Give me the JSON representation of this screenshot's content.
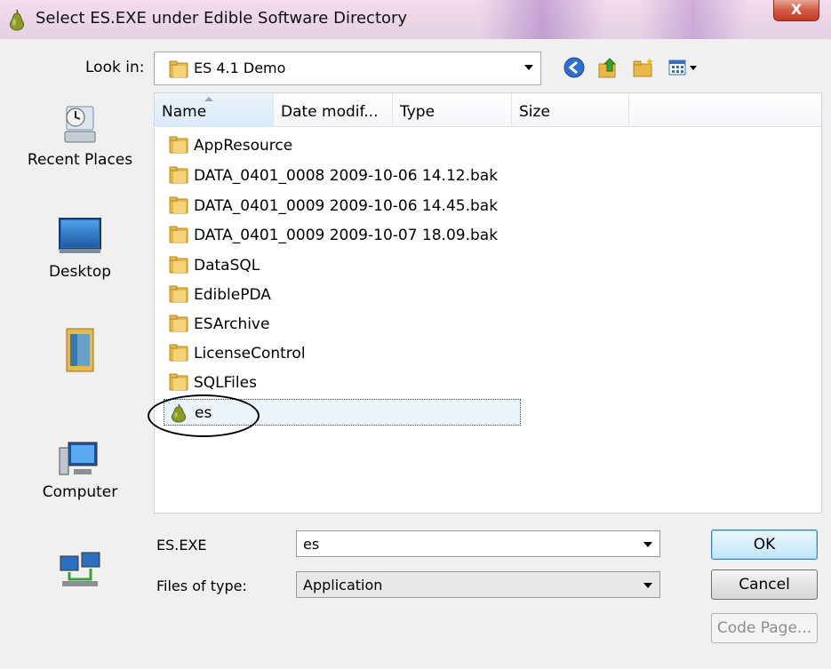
{
  "window": {
    "title": "Select ES.EXE under Edible Software Directory",
    "close_glyph": "X"
  },
  "toolbar": {
    "lookin_label": "Look in:",
    "lookin_value": "ES 4.1 Demo",
    "buttons": [
      "back-icon",
      "up-folder-icon",
      "new-folder-icon",
      "views-menu-icon"
    ]
  },
  "places": [
    {
      "label": "Recent Places",
      "icon": "recent-places-icon"
    },
    {
      "label": "Desktop",
      "icon": "desktop-icon"
    },
    {
      "label": "",
      "icon": "user-folder-icon"
    },
    {
      "label": "Computer",
      "icon": "computer-icon"
    },
    {
      "label": "",
      "icon": "network-icon"
    }
  ],
  "columns": [
    "Name",
    "Date modif...",
    "Type",
    "Size"
  ],
  "files": [
    {
      "name": "AppResource",
      "icon": "folder-icon"
    },
    {
      "name": "DATA_0401_0008 2009-10-06 14.12.bak",
      "icon": "folder-icon"
    },
    {
      "name": "DATA_0401_0009 2009-10-06 14.45.bak",
      "icon": "folder-icon"
    },
    {
      "name": "DATA_0401_0009 2009-10-07 18.09.bak",
      "icon": "folder-icon"
    },
    {
      "name": "DataSQL",
      "icon": "folder-icon"
    },
    {
      "name": "EdiblePDA",
      "icon": "folder-icon"
    },
    {
      "name": "ESArchive",
      "icon": "folder-icon"
    },
    {
      "name": "LicenseControl",
      "icon": "folder-icon"
    },
    {
      "name": "SQLFiles",
      "icon": "folder-icon"
    },
    {
      "name": "es",
      "icon": "pear-app-icon",
      "selected": true
    }
  ],
  "filename": {
    "label": "ES.EXE",
    "value": "es"
  },
  "filetype": {
    "label": "Files of type:",
    "value": "Application"
  },
  "buttons": {
    "ok": "OK",
    "cancel": "Cancel",
    "codepage": "Code Page..."
  },
  "colors": {
    "selection": "#eaf4fd",
    "accent": "#3c7fb1",
    "folder": "#e8b84a"
  }
}
